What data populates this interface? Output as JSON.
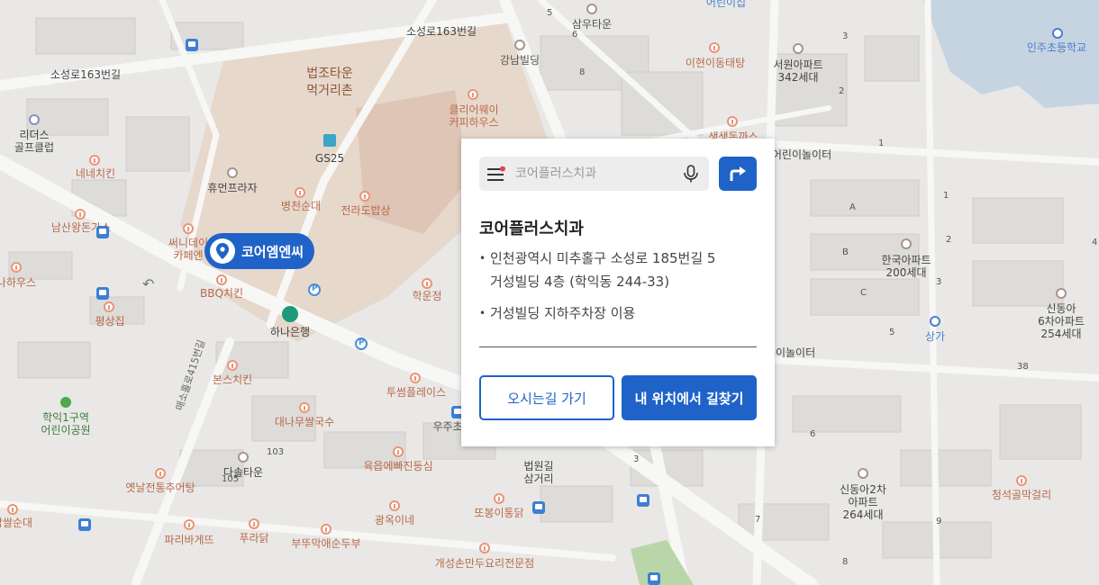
{
  "search": {
    "placeholder": "코어플러스치과"
  },
  "marker": {
    "label": "코어엠엔씨"
  },
  "place": {
    "title": "코어플러스치과",
    "address_line1": "인천광역시 미추홀구 소성로 185번길 5",
    "address_line2": "거성빌딩 4층 (학익동 244-33)",
    "parking": "거성빌딩 지하주차장 이용"
  },
  "buttons": {
    "visit": "오시는길 가기",
    "route": "내 위치에서 길찾기"
  },
  "colors": {
    "accent": "#1f63c9",
    "food_pin": "#e8957a",
    "bus_stop": "#3d7fd3",
    "map_bg": "#e9e8e6"
  },
  "map_labels": {
    "sosungro_163_top": "소성로163번길",
    "sosungro_163_left": "소성로163번길",
    "samwoo_town": "삼우타운",
    "uiyeon": "어린이집",
    "inju_school": "인주초등학교",
    "gangnam_bldg": "강남빌딩",
    "ihyeon_tang": "이현이동태탕",
    "seowon_apt": "서원아파트",
    "seowon_units": "342세대",
    "beopjo_1": "법조타운",
    "beopjo_2": "먹거리촌",
    "clearway_1": "클리어웨이",
    "clearway_2": "커피하우스",
    "saengsaeng": "생생돈까스",
    "daycare_right": "어린이놀이터",
    "leaders_1": "리더스",
    "leaders_2": "골프클럽",
    "gs25": "GS25",
    "nene": "네네치킨",
    "humanplaza": "휴먼프라자",
    "byeongcheon": "병천순대",
    "jeonla": "전라도밥상",
    "namsan": "남산왕돈가스",
    "sunny_1": "써니데이",
    "sunny_2": "카페엔",
    "bbq": "BBQ치킨",
    "hakunjeong": "학운정",
    "hana": "하나은행",
    "pyeongsang": "평상집",
    "nahaus": "나하우스",
    "bonsu": "본스치킨",
    "tusome": "투썸플레이스",
    "daena": "대나무쌀국수",
    "uju": "우주초",
    "hakik_park_1": "학익1구역",
    "hakik_park_2": "어린이공원",
    "street_415": "매소홀로415번길",
    "dasol": "다솔타운",
    "yukup": "육읍에빠진등심",
    "court_1": "법원길",
    "court_2": "삼거리",
    "yennal": "옛날전통추어탕",
    "ddobong": "또봉이통닭",
    "chapssal": "찹쌀순대",
    "gwangok": "광옥이네",
    "paris": "파리바게뜨",
    "puradak": "푸라닭",
    "bubu": "부뚜막애순두부",
    "gaeseong": "개성손만두요리전문점",
    "hanguk_apt": "한국아파트",
    "hanguk_units": "200세대",
    "sangga": "상가",
    "sindong6_1": "신동아",
    "sindong6_2": "6차아파트",
    "sindong6_3": "254세대",
    "sindong2_1": "신동아2차",
    "sindong2_2": "아파트",
    "sindong2_3": "264세대",
    "cheongseok": "청석골막걸리",
    "playground_mid": "어린이놀이터"
  }
}
